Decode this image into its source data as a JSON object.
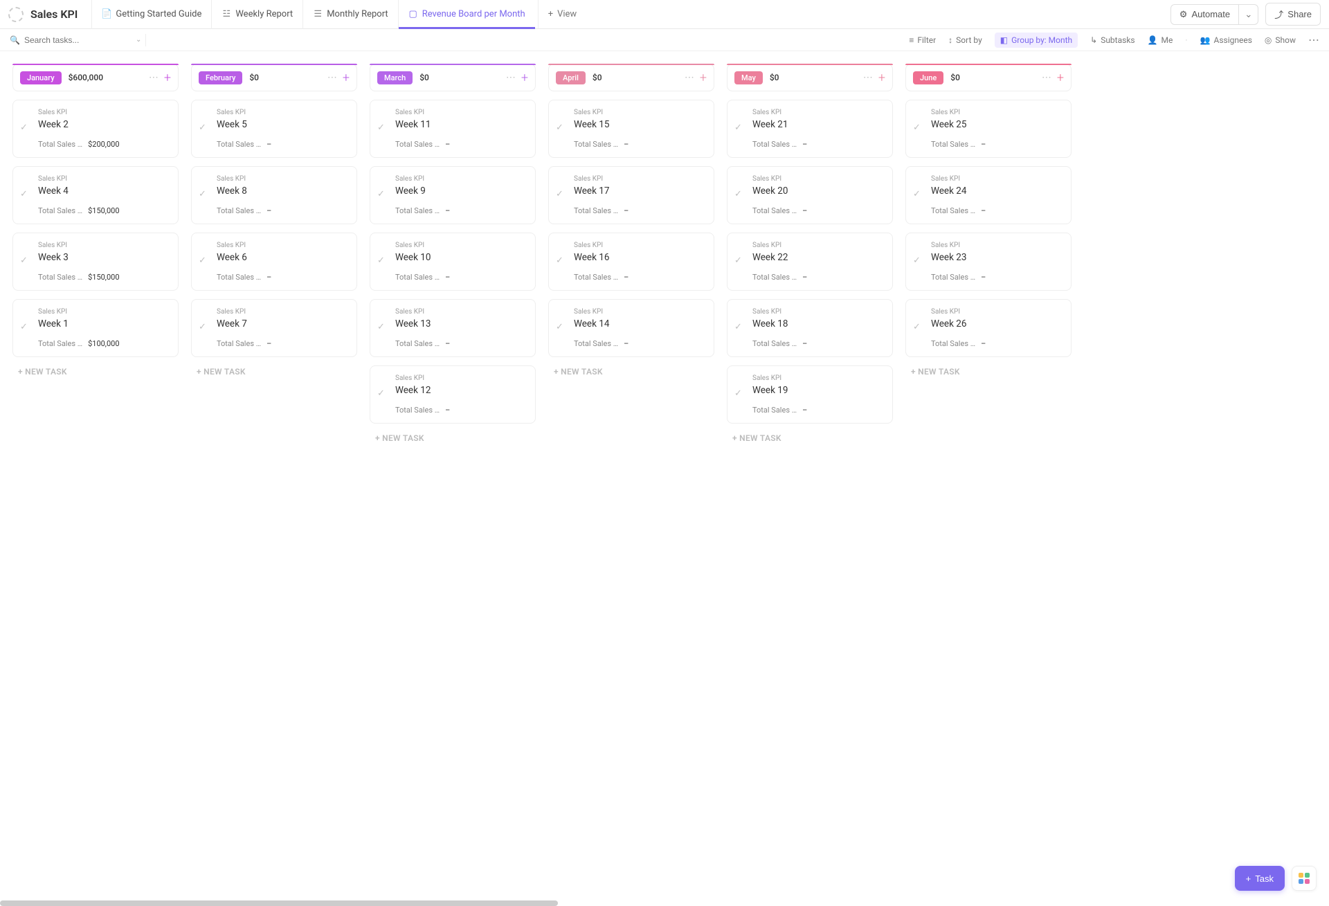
{
  "app": {
    "title": "Sales KPI"
  },
  "nav_tabs": [
    {
      "label": "Getting Started Guide",
      "icon": "📄"
    },
    {
      "label": "Weekly Report",
      "icon": "☳"
    },
    {
      "label": "Monthly Report",
      "icon": "☰"
    },
    {
      "label": "Revenue Board per Month",
      "icon": "▢",
      "active": true
    }
  ],
  "view_add": {
    "label": "View",
    "plus": "+"
  },
  "topbar_right": {
    "automate": "Automate",
    "share": "Share"
  },
  "toolbar": {
    "search_placeholder": "Search tasks...",
    "filter": "Filter",
    "sort": "Sort by",
    "group": "Group by: Month",
    "subtasks": "Subtasks",
    "me": "Me",
    "assignees": "Assignees",
    "show": "Show"
  },
  "card_meta": {
    "list_name": "Sales KPI",
    "field_label": "Total Sales …",
    "empty_val": "–"
  },
  "new_task_label": "+ NEW TASK",
  "fab": {
    "task": "Task",
    "plus": "+"
  },
  "columns": [
    {
      "name": "January",
      "amount": "$600,000",
      "pill_bg": "#c750e0",
      "accent": "#c750e0",
      "plus": "#c750e0",
      "cards": [
        {
          "title": "Week 2",
          "value": "$200,000"
        },
        {
          "title": "Week 4",
          "value": "$150,000"
        },
        {
          "title": "Week 3",
          "value": "$150,000"
        },
        {
          "title": "Week 1",
          "value": "$100,000"
        }
      ]
    },
    {
      "name": "February",
      "amount": "$0",
      "pill_bg": "#b95ee6",
      "accent": "#b95ee6",
      "plus": "#b95ee6",
      "cards": [
        {
          "title": "Week 5",
          "value": "–"
        },
        {
          "title": "Week 8",
          "value": "–"
        },
        {
          "title": "Week 6",
          "value": "–"
        },
        {
          "title": "Week 7",
          "value": "–"
        }
      ]
    },
    {
      "name": "March",
      "amount": "$0",
      "pill_bg": "#b567ea",
      "accent": "#b567ea",
      "plus": "#b567ea",
      "cards": [
        {
          "title": "Week 11",
          "value": "–"
        },
        {
          "title": "Week 9",
          "value": "–"
        },
        {
          "title": "Week 10",
          "value": "–"
        },
        {
          "title": "Week 13",
          "value": "–"
        },
        {
          "title": "Week 12",
          "value": "–"
        }
      ]
    },
    {
      "name": "April",
      "amount": "$0",
      "pill_bg": "#e88aa5",
      "accent": "#e88aa5",
      "plus": "#e88aa5",
      "cards": [
        {
          "title": "Week 15",
          "value": "–"
        },
        {
          "title": "Week 17",
          "value": "–"
        },
        {
          "title": "Week 16",
          "value": "–"
        },
        {
          "title": "Week 14",
          "value": "–"
        }
      ]
    },
    {
      "name": "May",
      "amount": "$0",
      "pill_bg": "#ec7f9b",
      "accent": "#ec7f9b",
      "plus": "#ec7f9b",
      "cards": [
        {
          "title": "Week 21",
          "value": "–"
        },
        {
          "title": "Week 20",
          "value": "–"
        },
        {
          "title": "Week 22",
          "value": "–"
        },
        {
          "title": "Week 18",
          "value": "–"
        },
        {
          "title": "Week 19",
          "value": "–"
        }
      ]
    },
    {
      "name": "June",
      "amount": "$0",
      "pill_bg": "#ef6f90",
      "accent": "#ef6f90",
      "plus": "#ef6f90",
      "cards": [
        {
          "title": "Week 25",
          "value": "–"
        },
        {
          "title": "Week 24",
          "value": "–"
        },
        {
          "title": "Week 23",
          "value": "–"
        },
        {
          "title": "Week 26",
          "value": "–"
        }
      ]
    }
  ]
}
